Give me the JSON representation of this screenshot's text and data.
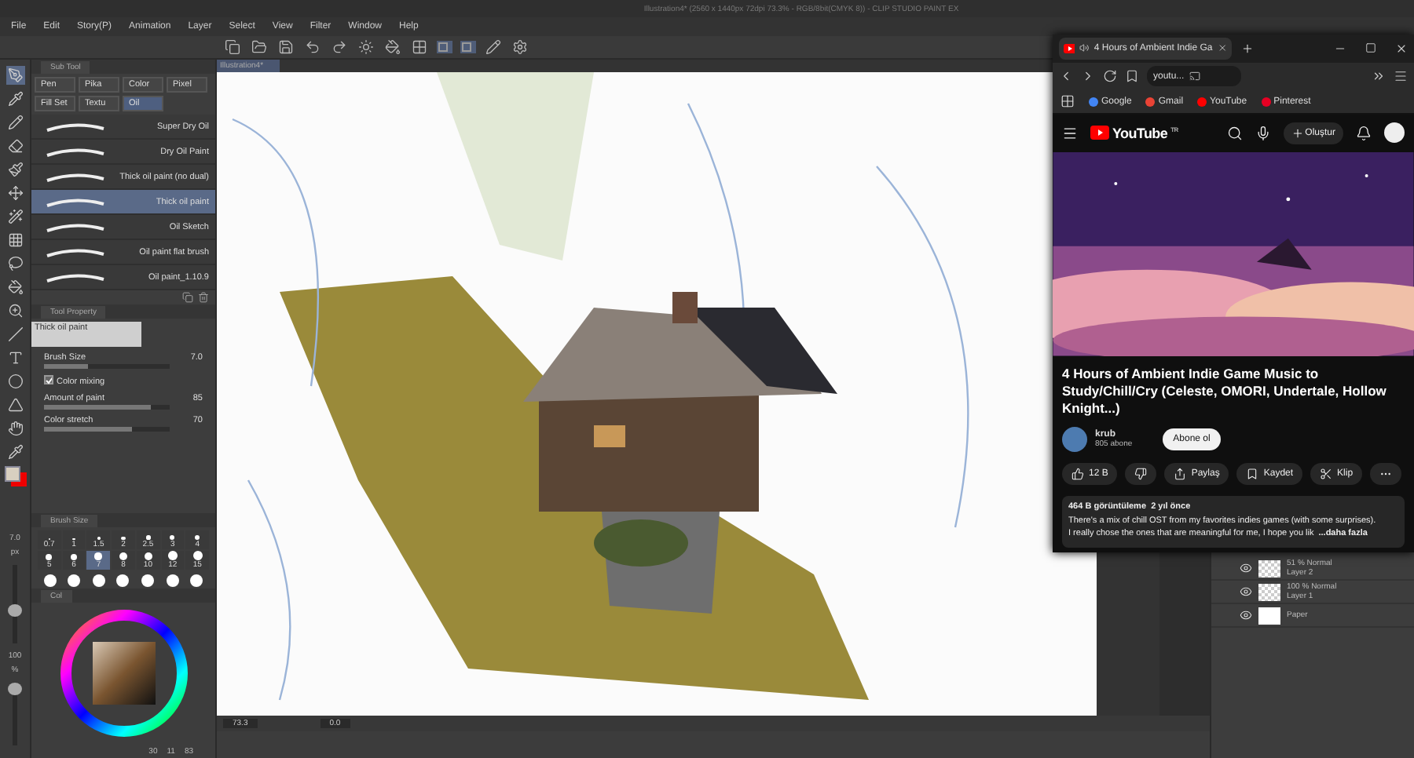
{
  "app_title": "Illustration4* (2560 x 1440px 72dpi 73.3% - RGB/8bit(CMYK 8)) - CLIP STUDIO PAINT EX",
  "menu": [
    "File",
    "Edit",
    "Story(P)",
    "Animation",
    "Layer",
    "Select",
    "View",
    "Filter",
    "Window",
    "Help"
  ],
  "document_tab": "Illustration4*",
  "sub_tool": {
    "tab": "Sub Tool",
    "groups": [
      {
        "label": "Pen",
        "selected": false
      },
      {
        "label": "Pika",
        "selected": false
      },
      {
        "label": "Color",
        "selected": false
      },
      {
        "label": "Pixel",
        "selected": false
      },
      {
        "label": "Fill Set",
        "selected": false
      },
      {
        "label": "Textu",
        "selected": false
      },
      {
        "label": "Oil",
        "selected": true
      }
    ],
    "brushes": [
      {
        "name": "Super Dry Oil",
        "selected": false
      },
      {
        "name": "Dry Oil Paint",
        "selected": false
      },
      {
        "name": "Thick oil paint (no dual)",
        "selected": false
      },
      {
        "name": "Thick oil paint",
        "selected": true
      },
      {
        "name": "Oil Sketch",
        "selected": false
      },
      {
        "name": "Oil paint flat brush",
        "selected": false
      },
      {
        "name": "Oil paint_1.10.9",
        "selected": false
      }
    ]
  },
  "tool_property": {
    "tab": "Tool Property",
    "preset": "Thick oil paint",
    "brush_size": {
      "label": "Brush Size",
      "value": "7.0",
      "level": 0.35
    },
    "color_mixing": {
      "label": "Color mixing",
      "checked": true
    },
    "amount": {
      "label": "Amount of paint",
      "value": "85",
      "level": 0.85
    },
    "stretch": {
      "label": "Color stretch",
      "value": "70",
      "level": 0.7
    }
  },
  "brush_size_panel": {
    "tab": "Brush Size",
    "sizes": [
      {
        "value": "0.7",
        "selected": false
      },
      {
        "value": "1",
        "selected": false
      },
      {
        "value": "1.5",
        "selected": false
      },
      {
        "value": "2",
        "selected": false
      },
      {
        "value": "2.5",
        "selected": false
      },
      {
        "value": "3",
        "selected": false
      },
      {
        "value": "4",
        "selected": false
      },
      {
        "value": "5",
        "selected": false
      },
      {
        "value": "6",
        "selected": false
      },
      {
        "value": "7",
        "selected": true
      },
      {
        "value": "8",
        "selected": false
      },
      {
        "value": "10",
        "selected": false
      },
      {
        "value": "12",
        "selected": false
      },
      {
        "value": "15",
        "selected": false
      }
    ]
  },
  "color_panel": {
    "tab": "Col",
    "readouts": [
      "30",
      "11",
      "83"
    ]
  },
  "tool_strip": {
    "size": {
      "value": "7.0",
      "unit": "px",
      "level": 0.4
    },
    "opacity": {
      "value": "100",
      "unit": "%",
      "level": 1
    }
  },
  "layers": [
    {
      "mode": "51 % Normal",
      "name": "Layer 2"
    },
    {
      "mode": "100 % Normal",
      "name": "Layer 1"
    },
    {
      "name": "Paper"
    }
  ],
  "status": {
    "zoom": "73.3",
    "angle": "0.0"
  },
  "browser": {
    "tab_title": "4 Hours of Ambient Indie Ga",
    "address": "youtu...",
    "bookmarks": [
      "Google",
      "Gmail",
      "YouTube",
      "Pinterest"
    ],
    "logo": "YouTube",
    "region": "TR",
    "create": "Oluştur",
    "video_title": "4 Hours of Ambient Indie Game Music to Study/Chill/Cry (Celeste, OMORI, Undertale, Hollow Knight...)",
    "channel": "krub",
    "subscribers": "805 abone",
    "subscribe": "Abone ol",
    "likes": "12 B",
    "share": "Paylaş",
    "save": "Kaydet",
    "clip": "Klip",
    "stats": "464 B görüntüleme  2 yıl önce",
    "description": [
      "There's a mix of chill OST from my favorites indies games (with some surprises).",
      "I really chose the ones that are meaningful for me, I hope you lik"
    ],
    "more": "...daha fazla"
  }
}
